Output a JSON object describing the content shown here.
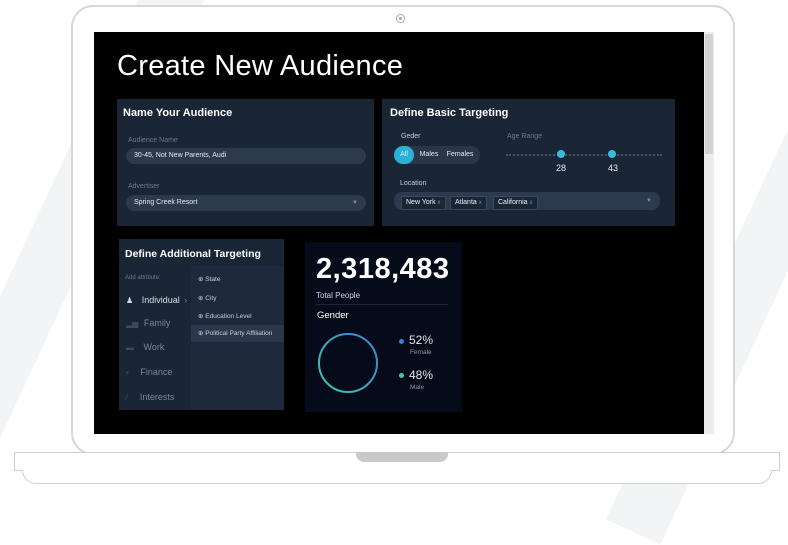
{
  "page": {
    "title": "Create New Audience"
  },
  "name_card": {
    "heading": "Name Your Audience",
    "audience_label": "Audience Name",
    "audience_value": "30-45, Not New Parents, Audi",
    "advertiser_label": "Advertiser",
    "advertiser_value": "Spring Creek Resort"
  },
  "basic_targeting": {
    "heading": "Define Basic Targeting",
    "gender_label": "Geder",
    "gender_options": [
      "All",
      "Males",
      "Females"
    ],
    "gender_selected": "All",
    "age_label": "Age Range",
    "age_min": "28",
    "age_max": "43",
    "location_label": "Location",
    "locations": [
      "New York",
      "Atlanta",
      "California"
    ]
  },
  "additional_targeting": {
    "heading": "Define Additional Targeting",
    "add_attribute_label": "Add attribute:",
    "categories": [
      "Individual",
      "Family",
      "Work",
      "Finance",
      "Interests"
    ],
    "selected_category": "Individual",
    "attributes": [
      "State",
      "City",
      "Education Level",
      "Political Party Affiliation"
    ],
    "highlighted_attribute": "Political Party Affiliation"
  },
  "stats": {
    "total": "2,318,483",
    "total_label": "Total People",
    "gender_heading": "Gender",
    "female_pct": "52%",
    "female_label": "Female",
    "male_pct": "48%",
    "male_label": "Male"
  },
  "colors": {
    "accent": "#29b2d6",
    "female": "#3a7fd5",
    "male": "#3fc9a6",
    "card": "#1a2536"
  },
  "icons": {
    "individual": "person-icon",
    "family": "bar-chart-icon",
    "work": "briefcase-icon",
    "finance": "money-icon",
    "interests": "brush-icon",
    "attribute": "plus-circle-icon",
    "dropdown": "chevron-down-icon",
    "remove": "close-icon"
  }
}
